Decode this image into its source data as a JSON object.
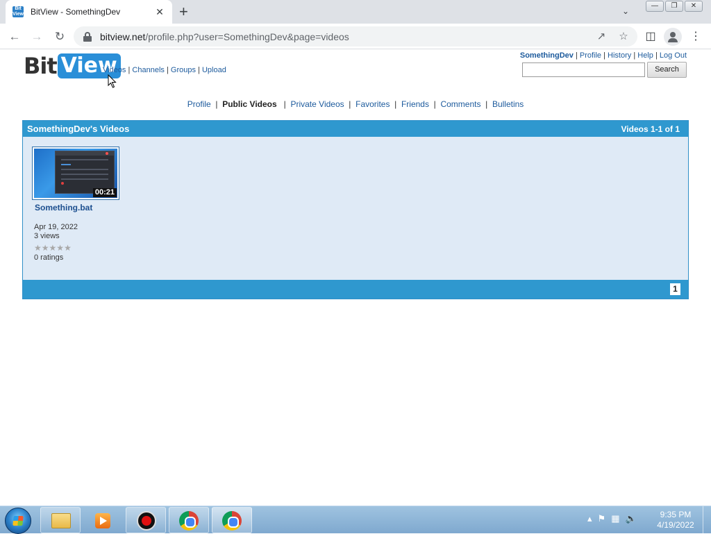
{
  "browser": {
    "tab_title": "BitView - SomethingDev",
    "favicon_text": "Bit View",
    "new_tab_symbol": "+",
    "close_symbol": "✕",
    "url_host": "bitview.net",
    "url_rest": "/profile.php?user=SomethingDev&page=videos"
  },
  "site": {
    "logo_bit": "Bit",
    "logo_view": "View",
    "main_nav": [
      "Videos",
      "Channels",
      "Groups",
      "Upload"
    ],
    "user_nav": {
      "username": "SomethingDev",
      "links": [
        "Profile",
        "History",
        "Help",
        "Log Out"
      ]
    },
    "search_button": "Search",
    "sub_nav": {
      "items": [
        "Profile",
        "Public Videos",
        "Private Videos",
        "Favorites",
        "Friends",
        "Comments",
        "Bulletins"
      ],
      "active": "Public Videos"
    }
  },
  "panel": {
    "title": "SomethingDev's Videos",
    "count": "Videos 1-1 of 1",
    "page": "1",
    "videos": [
      {
        "title": "Something.bat",
        "duration": "00:21",
        "date": "Apr 19, 2022",
        "views": "3 views",
        "ratings": "0 ratings",
        "rating_stars": 0,
        "rating_max": 5
      }
    ]
  },
  "taskbar": {
    "time": "9:35 PM",
    "date": "4/19/2022",
    "items": [
      "explorer-icon",
      "media-player-icon",
      "recorder-icon",
      "chrome-profile-icon",
      "chrome-icon"
    ]
  },
  "colors": {
    "panel_header": "#2f98cf",
    "panel_body": "#dfeaf6",
    "link": "#1c5a9c"
  }
}
